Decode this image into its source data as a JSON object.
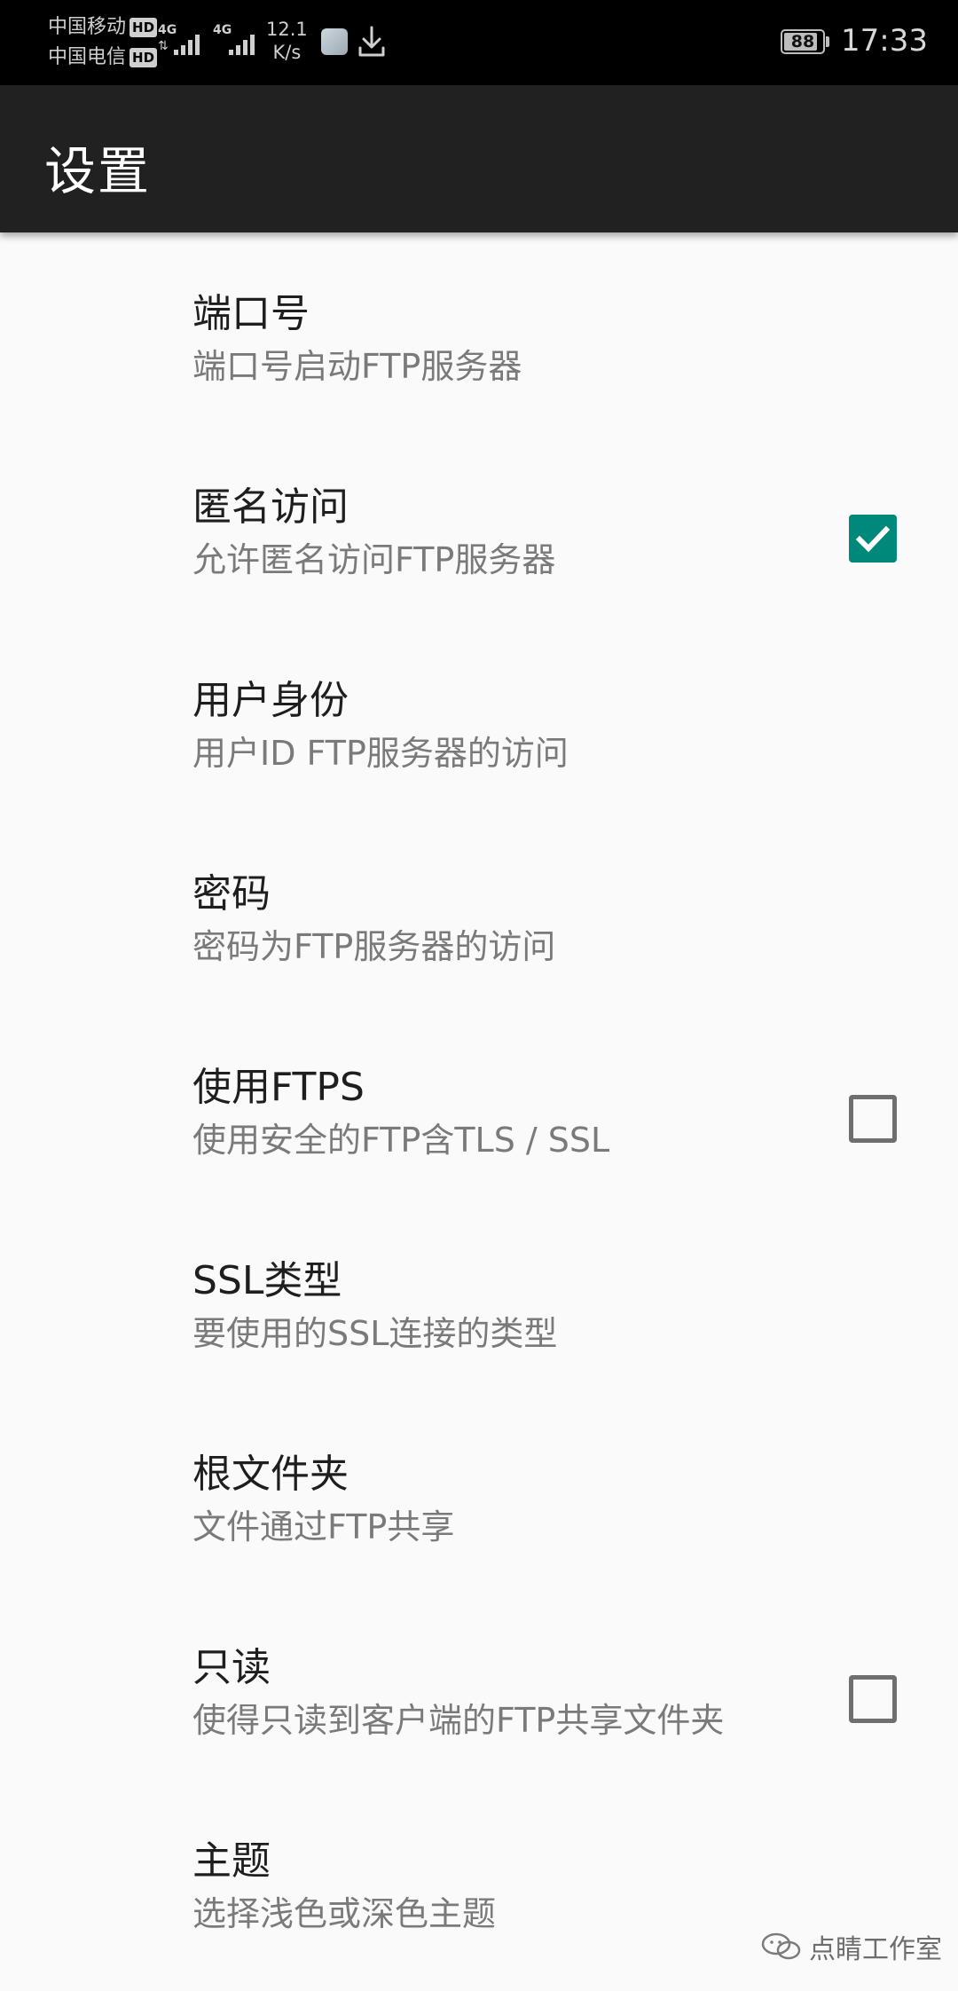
{
  "status_bar": {
    "carriers": [
      {
        "name": "中国移动",
        "badge": "HD"
      },
      {
        "name": "中国电信",
        "badge": "HD"
      }
    ],
    "network_type_1": "4G",
    "network_type_2": "4G",
    "speed_value": "12.1",
    "speed_unit": "K/s",
    "battery_percent": 88,
    "battery_label": "88",
    "time": "17:33",
    "icons": [
      "app-notification-icon",
      "download-icon"
    ]
  },
  "toolbar": {
    "title": "设置"
  },
  "preferences": [
    {
      "title": "端口号",
      "summary": "端口号启动FTP服务器",
      "checkbox": null
    },
    {
      "title": "匿名访问",
      "summary": "允许匿名访问FTP服务器",
      "checkbox": true
    },
    {
      "title": "用户身份",
      "summary": "用户ID FTP服务器的访问",
      "checkbox": null
    },
    {
      "title": "密码",
      "summary": "密码为FTP服务器的访问",
      "checkbox": null
    },
    {
      "title": "使用FTPS",
      "summary": "使用安全的FTP含TLS / SSL",
      "checkbox": false
    },
    {
      "title": "SSL类型",
      "summary": "要使用的SSL连接的类型",
      "checkbox": null
    },
    {
      "title": "根文件夹",
      "summary": "文件通过FTP共享",
      "checkbox": null
    },
    {
      "title": "只读",
      "summary": "使得只读到客户端的FTP共享文件夹",
      "checkbox": false
    },
    {
      "title": "主题",
      "summary": "选择浅色或深色主题",
      "checkbox": null
    }
  ],
  "colors": {
    "accent": "#00897b",
    "toolbar_bg": "#212121",
    "status_bar_bg": "#000000",
    "background": "#fafafa"
  },
  "watermark": {
    "text": "点睛工作室"
  }
}
